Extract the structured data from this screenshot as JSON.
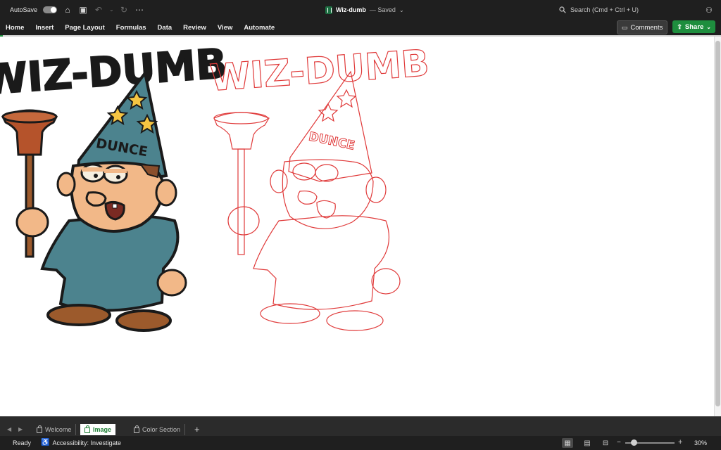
{
  "titlebar": {
    "autosave_label": "AutoSave",
    "doc_title": "Wiz-dumb",
    "doc_status": "— Saved",
    "search_placeholder": "Search (Cmd + Ctrl + U)"
  },
  "ribbon": {
    "tabs": [
      "Home",
      "Insert",
      "Page Layout",
      "Formulas",
      "Data",
      "Review",
      "View",
      "Automate"
    ],
    "comments_label": "Comments",
    "share_label": "Share"
  },
  "art": {
    "banner_text": "WIZ-DUMB",
    "hat_text": "DUNCE",
    "outline_banner_text": "WIZ-DUMB",
    "outline_hat_text": "DUNCE",
    "colors": {
      "robe": "#4c838e",
      "skin": "#f2b888",
      "hat": "#4c838e",
      "star": "#f5c542",
      "plunger": "#b5532b",
      "handle": "#9c5a2c",
      "shoe": "#9c5a2c",
      "outline": "#e03a3a",
      "ink": "#1a1a1a"
    }
  },
  "sheet_tabs": [
    {
      "label": "Welcome",
      "active": false
    },
    {
      "label": "Image",
      "active": true
    },
    {
      "label": "Color Section",
      "active": false
    }
  ],
  "status": {
    "ready": "Ready",
    "accessibility": "Accessibility: Investigate",
    "zoom_level": "30%",
    "zoom_fraction": 0.18
  }
}
